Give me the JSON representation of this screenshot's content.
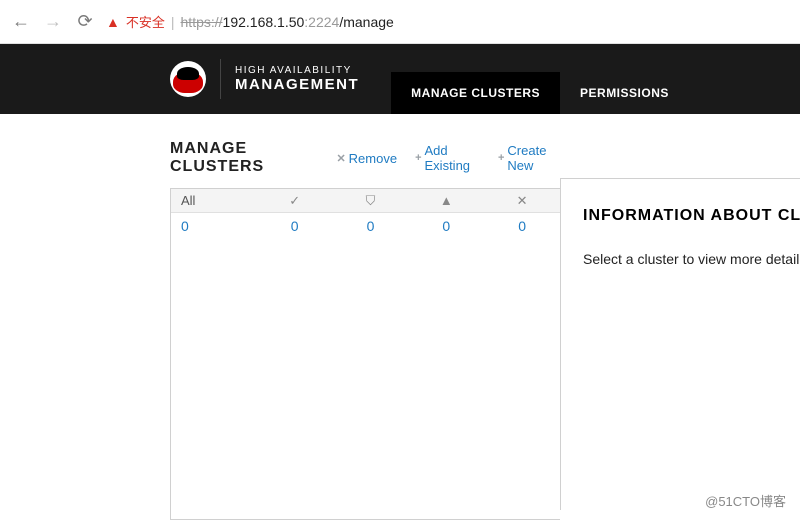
{
  "browser": {
    "insecure_label": "不安全",
    "url_proto": "https://",
    "url_host": "192.168.1.50",
    "url_port": ":2224",
    "url_path": "/manage"
  },
  "header": {
    "brand_top": "HIGH AVAILABILITY",
    "brand_bottom": "MANAGEMENT",
    "tabs": [
      {
        "label": "MANAGE CLUSTERS",
        "active": true
      },
      {
        "label": "PERMISSIONS",
        "active": false
      }
    ]
  },
  "page": {
    "title": "MANAGE CLUSTERS",
    "actions": {
      "remove": "Remove",
      "add_existing": "Add Existing",
      "create_new": "Create New"
    },
    "filters": {
      "all_label": "All"
    },
    "counts": {
      "all": "0",
      "ok": "0",
      "error": "0",
      "warn": "0",
      "offline": "0"
    }
  },
  "info": {
    "title": "INFORMATION ABOUT CLUSTERS",
    "empty_text": "Select a cluster to view more detailed information here."
  },
  "watermark": "@51CTO博客"
}
